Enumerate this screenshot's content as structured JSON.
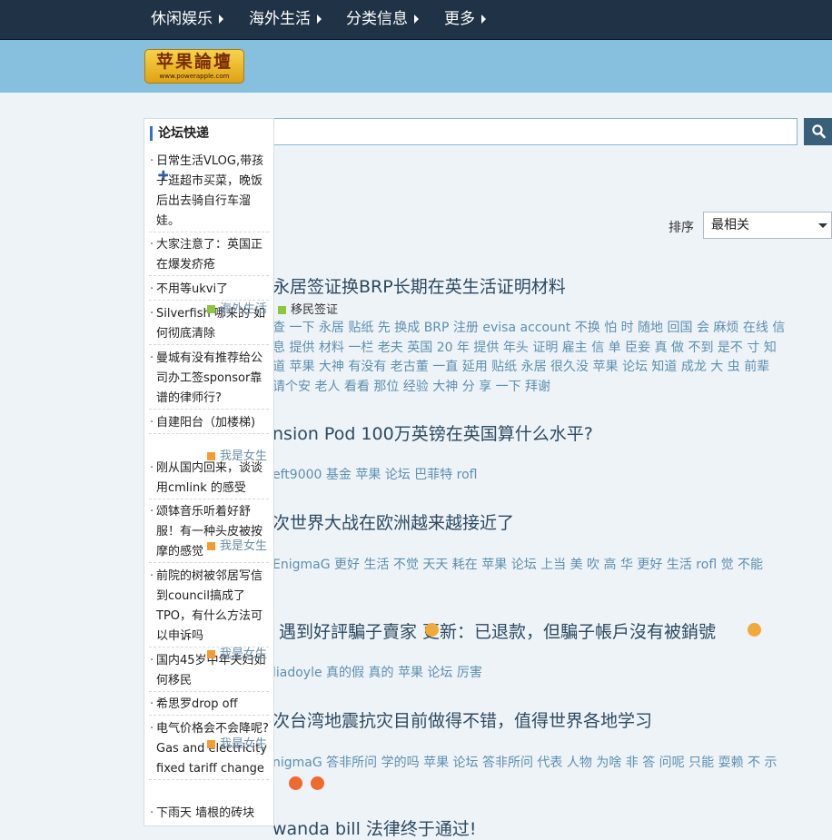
{
  "nav": {
    "items": [
      {
        "label": "休闲娱乐"
      },
      {
        "label": "海外生活"
      },
      {
        "label": "分类信息"
      },
      {
        "label": "更多"
      }
    ]
  },
  "logo": {
    "main": "苹果論壇",
    "sub": "www.powerapple.com"
  },
  "sort": {
    "label": "排序",
    "selected": "最相关"
  },
  "category": {
    "label": "移民签证"
  },
  "floating_tags": [
    {
      "label": "海外生活"
    },
    {
      "label": "我是女生"
    },
    {
      "label": "我是女生"
    },
    {
      "label": "我是女生"
    },
    {
      "label": "我是女生"
    }
  ],
  "sidebar": {
    "title": "论坛快递",
    "items": [
      {
        "text": "日常生活VLOG,带孩子逛超市买菜，晚饭后出去骑自行车溜娃。"
      },
      {
        "text": "大家注意了：英国正在爆发疥疮"
      },
      {
        "text": "不用等ukvi了"
      },
      {
        "text": "Silverfish 哪来的 如何彻底清除"
      },
      {
        "text": "曼城有没有推荐给公司办工签sponsor靠谱的律师行?"
      },
      {
        "text": "自建阳台（加楼梯)"
      },
      {
        "text": "刚从国内回来，谈谈用cmlink 的感受"
      },
      {
        "text": "颂钵音乐听着好舒服！有一种头皮被按摩的感觉"
      },
      {
        "text": "前院的树被邻居写信到council搞成了TPO，有什么方法可以申诉吗"
      },
      {
        "text": "国内45岁中年夫妇如何移民"
      },
      {
        "text": "希思罗drop off"
      },
      {
        "text": "电气价格会不会降呢? Gas and electricity fixed tariff change"
      },
      {
        "text": "下雨天 墙根的砖块"
      }
    ]
  },
  "results": [
    {
      "title": "永居签证换BRP长期在英生活证明材料",
      "tags": "查 一下 永居 贴纸 先 换成 BRP 注册 evisa account 不换 怕 时 随地 回国 会 麻烦 在线 信息 提供 材料 一栏 老夫 英国 20 年 提供 年头 证明 雇主 信 单 臣妾 真 做 不到 是不 寸 知道 苹果 大神 有没有 老古董 一直 延用 贴纸 永居 很久没 苹果 论坛 知道 成龙 大 虫 前辈 请个安 老人 看看 那位 经验 大神 分 享 一下 拜谢"
    },
    {
      "title": "nsion Pod 100万英镑在英国算什么水平?",
      "tags": "eft9000 基金 苹果 论坛 巴菲特 rofl"
    },
    {
      "title": "次世界大战在欧洲越来越接近了",
      "tags": "EnigmaG 更好 生活 不觉 天天 耗在 苹果 论坛 上当 美 吹 高 华 更好 生活 rofl 觉 不能"
    },
    {
      "title": "遇到好評騙子賣家 更新：已退款，但騙子帳戶沒有被銷號",
      "tags": "liadoyle 真的假 真的 苹果 论坛 厉害"
    },
    {
      "title": "次台湾地震抗灾目前做得不错，值得世界各地学习",
      "tags": "nigmaG 答非所问 学的吗 苹果 论坛 答非所问 代表 人物 为啥 非 答 问呢 只能 耍赖 不 示"
    },
    {
      "title": "wanda bill 法律终于通过!",
      "tags": ""
    }
  ]
}
